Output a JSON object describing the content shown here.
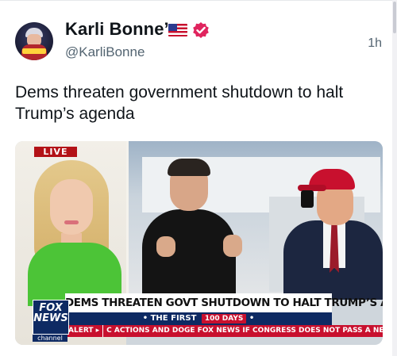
{
  "post": {
    "author_name": "Karli Bonne’",
    "handle": "@KarliBonne",
    "time": "1h",
    "text": "Dems threaten government shutdown to halt Trump’s agenda",
    "avatar_icon": "profile-avatar",
    "flag_icon": "us-flag-icon",
    "verified_icon": "verified-badge-icon",
    "verified_color": "#e0245e"
  },
  "media": {
    "live_label": "LIVE",
    "headline": "DEMS THREATEN GOVT SHUTDOWN TO HALT TRUMP’S AGENDA",
    "subhead_prefix": "• THE FIRST",
    "subhead_badge": "100 DAYS",
    "subhead_suffix": "•",
    "ticker_alert": "ALERT ▸",
    "ticker_text": "C ACTIONS AND DOGE   FOX NEWS  IF CONGRESS DOES NOT PASS A NEW SPE",
    "logo_line1": "FOX",
    "logo_line2": "NEWS",
    "logo_channel": "channel",
    "accent_red": "#c8102e",
    "accent_navy": "#0e2a63"
  }
}
